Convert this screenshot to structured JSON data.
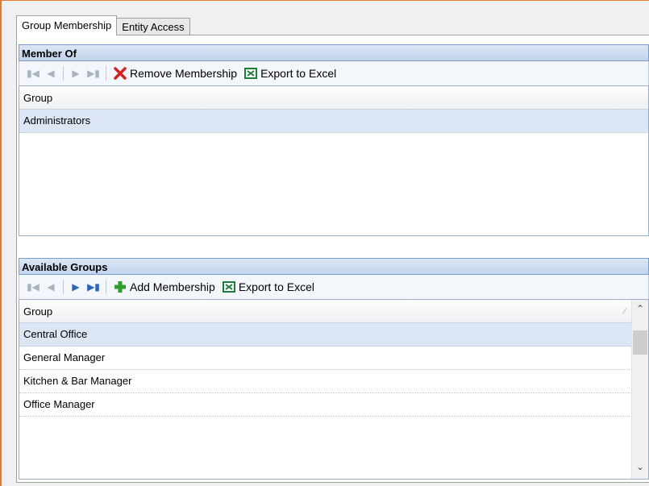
{
  "tabs": [
    {
      "label": "Group Membership"
    },
    {
      "label": "Entity Access"
    }
  ],
  "member_of": {
    "title": "Member Of",
    "toolbar": {
      "remove_label": "Remove Membership",
      "export_label": "Export to Excel"
    },
    "column": "Group",
    "rows": [
      "Administrators"
    ]
  },
  "available": {
    "title": "Available Groups",
    "toolbar": {
      "add_label": "Add Membership",
      "export_label": "Export to Excel"
    },
    "column": "Group",
    "rows": [
      "Central Office",
      "General Manager",
      "Kitchen & Bar Manager",
      "Office Manager"
    ]
  },
  "icons": {
    "first": "first-page-icon",
    "prev": "previous-page-icon",
    "next": "next-page-icon",
    "last": "last-page-icon",
    "remove": "red-x-icon",
    "add": "green-plus-icon",
    "excel": "excel-icon"
  },
  "colors": {
    "accent_border": "#e87a2c",
    "header_bg": "#c3d4ec",
    "selected_row": "#dce6f4"
  }
}
